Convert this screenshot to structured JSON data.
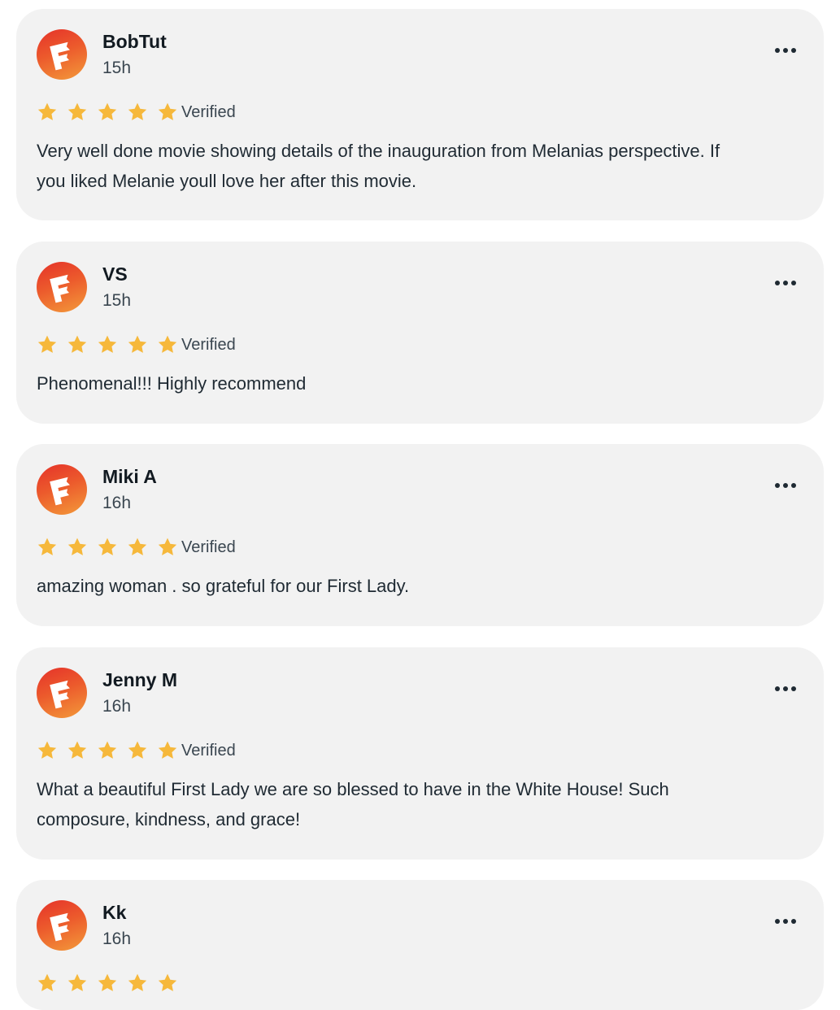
{
  "accent": {
    "star": "#f6b83b",
    "avatar_top": "#e5322a",
    "avatar_bottom": "#f39a3a"
  },
  "reviews": [
    {
      "author": "BobTut",
      "time": "15h",
      "rating": 5,
      "badge": "Verified",
      "text": "Very well done movie showing details of the inauguration from Melanias perspective. If\nyou liked Melanie youll love her after this movie."
    },
    {
      "author": "VS",
      "time": "15h",
      "rating": 5,
      "badge": "Verified",
      "text": "Phenomenal!!! Highly recommend"
    },
    {
      "author": "Miki A",
      "time": "16h",
      "rating": 5,
      "badge": "Verified",
      "text": "amazing woman . so grateful for our First Lady."
    },
    {
      "author": "Jenny M",
      "time": "16h",
      "rating": 5,
      "badge": "Verified",
      "text": "What a beautiful First Lady we are so blessed to have in the White House! Such\ncomposure, kindness, and grace!"
    },
    {
      "author": "Kk",
      "time": "16h",
      "rating": 5,
      "badge": "",
      "text": ""
    }
  ],
  "icons": {
    "avatar": "fandango-logo-icon",
    "menu": "more-options-icon",
    "star": "star-icon"
  }
}
